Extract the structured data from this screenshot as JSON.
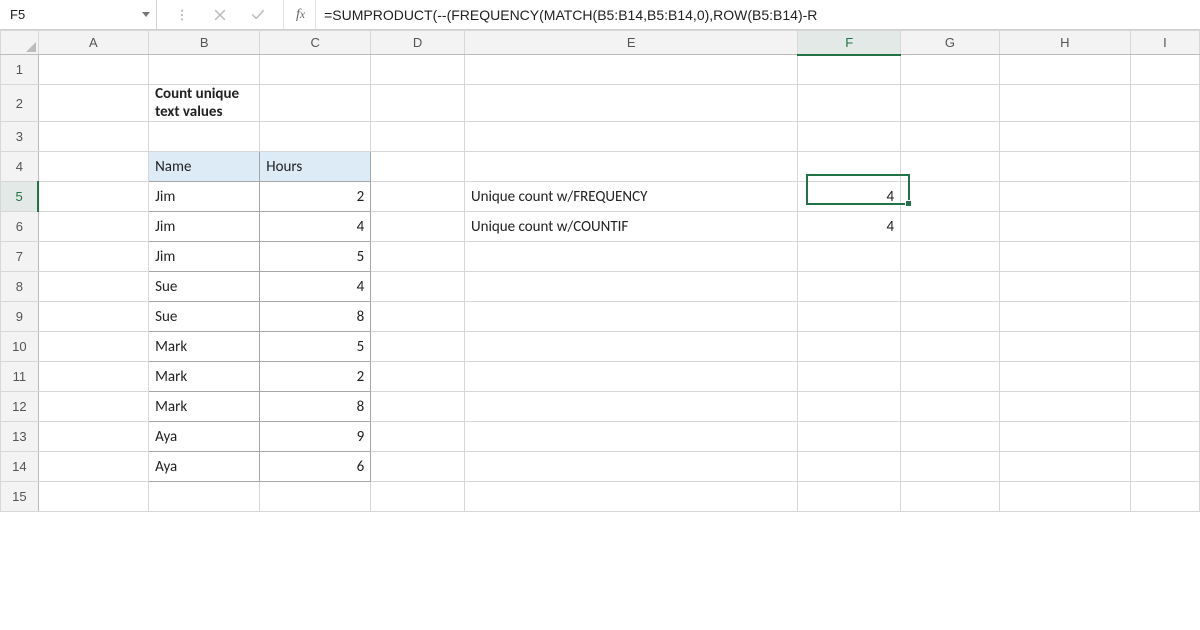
{
  "namebox": {
    "value": "F5"
  },
  "formula_bar": {
    "formula": "=SUMPRODUCT(--(FREQUENCY(MATCH(B5:B14,B5:B14,0),ROW(B5:B14)-R"
  },
  "columns": [
    "A",
    "B",
    "C",
    "D",
    "E",
    "F",
    "G",
    "H",
    "I"
  ],
  "rows": [
    "1",
    "2",
    "3",
    "4",
    "5",
    "6",
    "7",
    "8",
    "9",
    "10",
    "11",
    "12",
    "13",
    "14",
    "15"
  ],
  "selected": {
    "col": "F",
    "row": "5"
  },
  "title_cell": "Count unique text values",
  "headers": {
    "name": "Name",
    "hours": "Hours"
  },
  "data_rows": [
    {
      "name": "Jim",
      "hours": 2
    },
    {
      "name": "Jim",
      "hours": 4
    },
    {
      "name": "Jim",
      "hours": 5
    },
    {
      "name": "Sue",
      "hours": 4
    },
    {
      "name": "Sue",
      "hours": 8
    },
    {
      "name": "Mark",
      "hours": 5
    },
    {
      "name": "Mark",
      "hours": 2
    },
    {
      "name": "Mark",
      "hours": 8
    },
    {
      "name": "Aya",
      "hours": 9
    },
    {
      "name": "Aya",
      "hours": 6
    }
  ],
  "labels": {
    "freq": "Unique count w/FREQUENCY",
    "countif": "Unique count w/COUNTIF"
  },
  "results": {
    "freq": 4,
    "countif": 4
  },
  "chart_data": {
    "type": "table",
    "title": "Count unique text values",
    "columns": [
      "Name",
      "Hours"
    ],
    "rows": [
      [
        "Jim",
        2
      ],
      [
        "Jim",
        4
      ],
      [
        "Jim",
        5
      ],
      [
        "Sue",
        4
      ],
      [
        "Sue",
        8
      ],
      [
        "Mark",
        5
      ],
      [
        "Mark",
        2
      ],
      [
        "Mark",
        8
      ],
      [
        "Aya",
        9
      ],
      [
        "Aya",
        6
      ]
    ],
    "summary": [
      {
        "label": "Unique count w/FREQUENCY",
        "value": 4
      },
      {
        "label": "Unique count w/COUNTIF",
        "value": 4
      }
    ]
  }
}
